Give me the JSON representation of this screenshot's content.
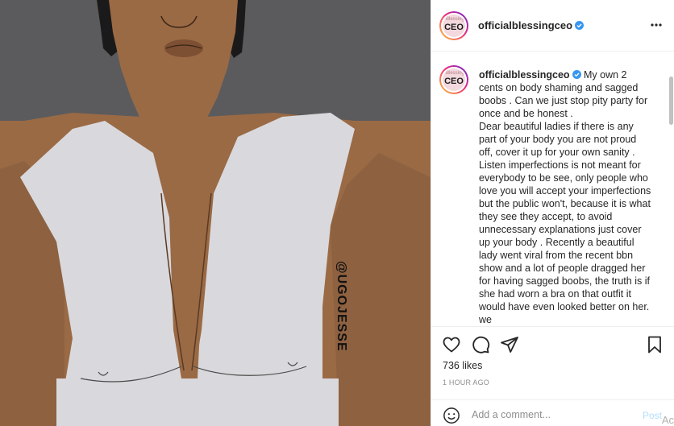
{
  "media": {
    "watermark": "@UGOJESSE"
  },
  "avatar": {
    "top_text": "Blessing",
    "main_text": "CEO"
  },
  "header": {
    "username": "officialblessingceo"
  },
  "caption": {
    "username": "officialblessingceo",
    "lines": [
      " My own 2 cents on body shaming and sagged boobs . Can we just stop pity party for once and be honest .",
      "Dear beautiful ladies if there is any part of your body you are not proud off, cover it up for your own sanity . Listen imperfections is not meant for everybody to be see, only people who love you will accept your imperfections but the public won't, because it is what they see they accept, to avoid unnecessary explanations just cover up your body . Recently a beautiful lady went viral from the recent bbn show and a lot of people dragged her for having sagged boobs, the truth is if she had worn a bra on that outfit it would have even looked better on her. we"
    ]
  },
  "actions": {
    "like_icon": "heart-icon",
    "comment_icon": "comment-icon",
    "share_icon": "paper-plane-icon",
    "save_icon": "bookmark-icon"
  },
  "stats": {
    "likes": "736 likes",
    "time": "1 HOUR AGO"
  },
  "comment": {
    "placeholder": "Add a comment...",
    "post_label": "Post",
    "ad_tag": "Ac"
  },
  "colors": {
    "verified": "#3897f0",
    "post_disabled": "#b2dffc",
    "background": "#5b5b5d"
  }
}
